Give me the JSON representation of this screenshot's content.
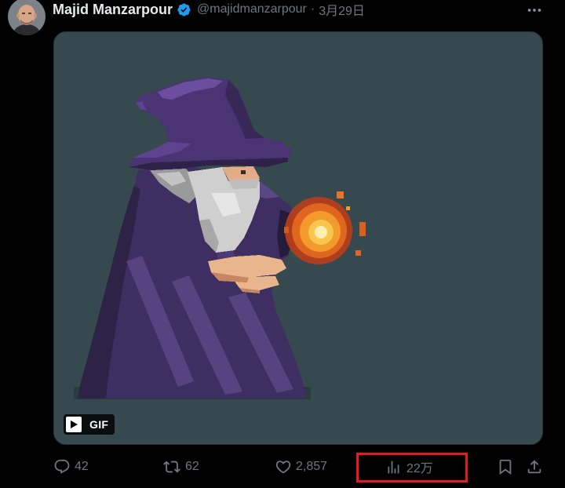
{
  "tweet": {
    "author_name": "Majid Manzarpour",
    "verified": true,
    "handle": "@majidmanzarpour",
    "separator": "·",
    "date": "3月29日"
  },
  "media": {
    "badge_label": "GIF",
    "background_color": "#35494e"
  },
  "actions": {
    "reply_count": "42",
    "retweet_count": "62",
    "like_count": "2,857",
    "view_count": "22万"
  },
  "icons": {
    "verified": "verified-badge-icon",
    "more": "more-icon",
    "play": "play-icon",
    "reply": "reply-icon",
    "retweet": "retweet-icon",
    "like": "heart-icon",
    "views": "views-chart-icon",
    "bookmark": "bookmark-icon",
    "share": "share-icon"
  },
  "colors": {
    "page_background": "#000000",
    "primary_text": "#e7e9ea",
    "secondary_text": "#71767b",
    "verified_blue": "#1d9bf0",
    "highlight_box": "#e5191f"
  }
}
